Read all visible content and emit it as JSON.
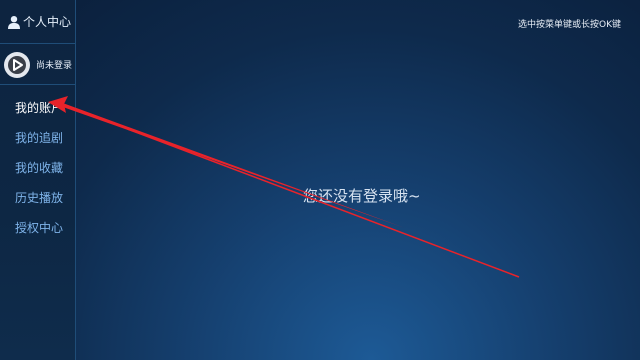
{
  "sidebar": {
    "header": {
      "title": "个人中心",
      "icon": "person-icon"
    },
    "user": {
      "status": "尚未登录",
      "avatar_icon": "play-logo-icon"
    },
    "items": [
      {
        "label": "我的账户",
        "active": true
      },
      {
        "label": "我的追剧",
        "active": false
      },
      {
        "label": "我的收藏",
        "active": false
      },
      {
        "label": "历史播放",
        "active": false
      },
      {
        "label": "授权中心",
        "active": false
      }
    ]
  },
  "hint": "选中按菜单键或长按OK键",
  "main": {
    "empty_message": "您还没有登录哦~"
  },
  "colors": {
    "menu_text": "#7fb4ea",
    "active_text": "#ffffff",
    "arrow": "#e8232a",
    "divider": "#1f4d78"
  }
}
